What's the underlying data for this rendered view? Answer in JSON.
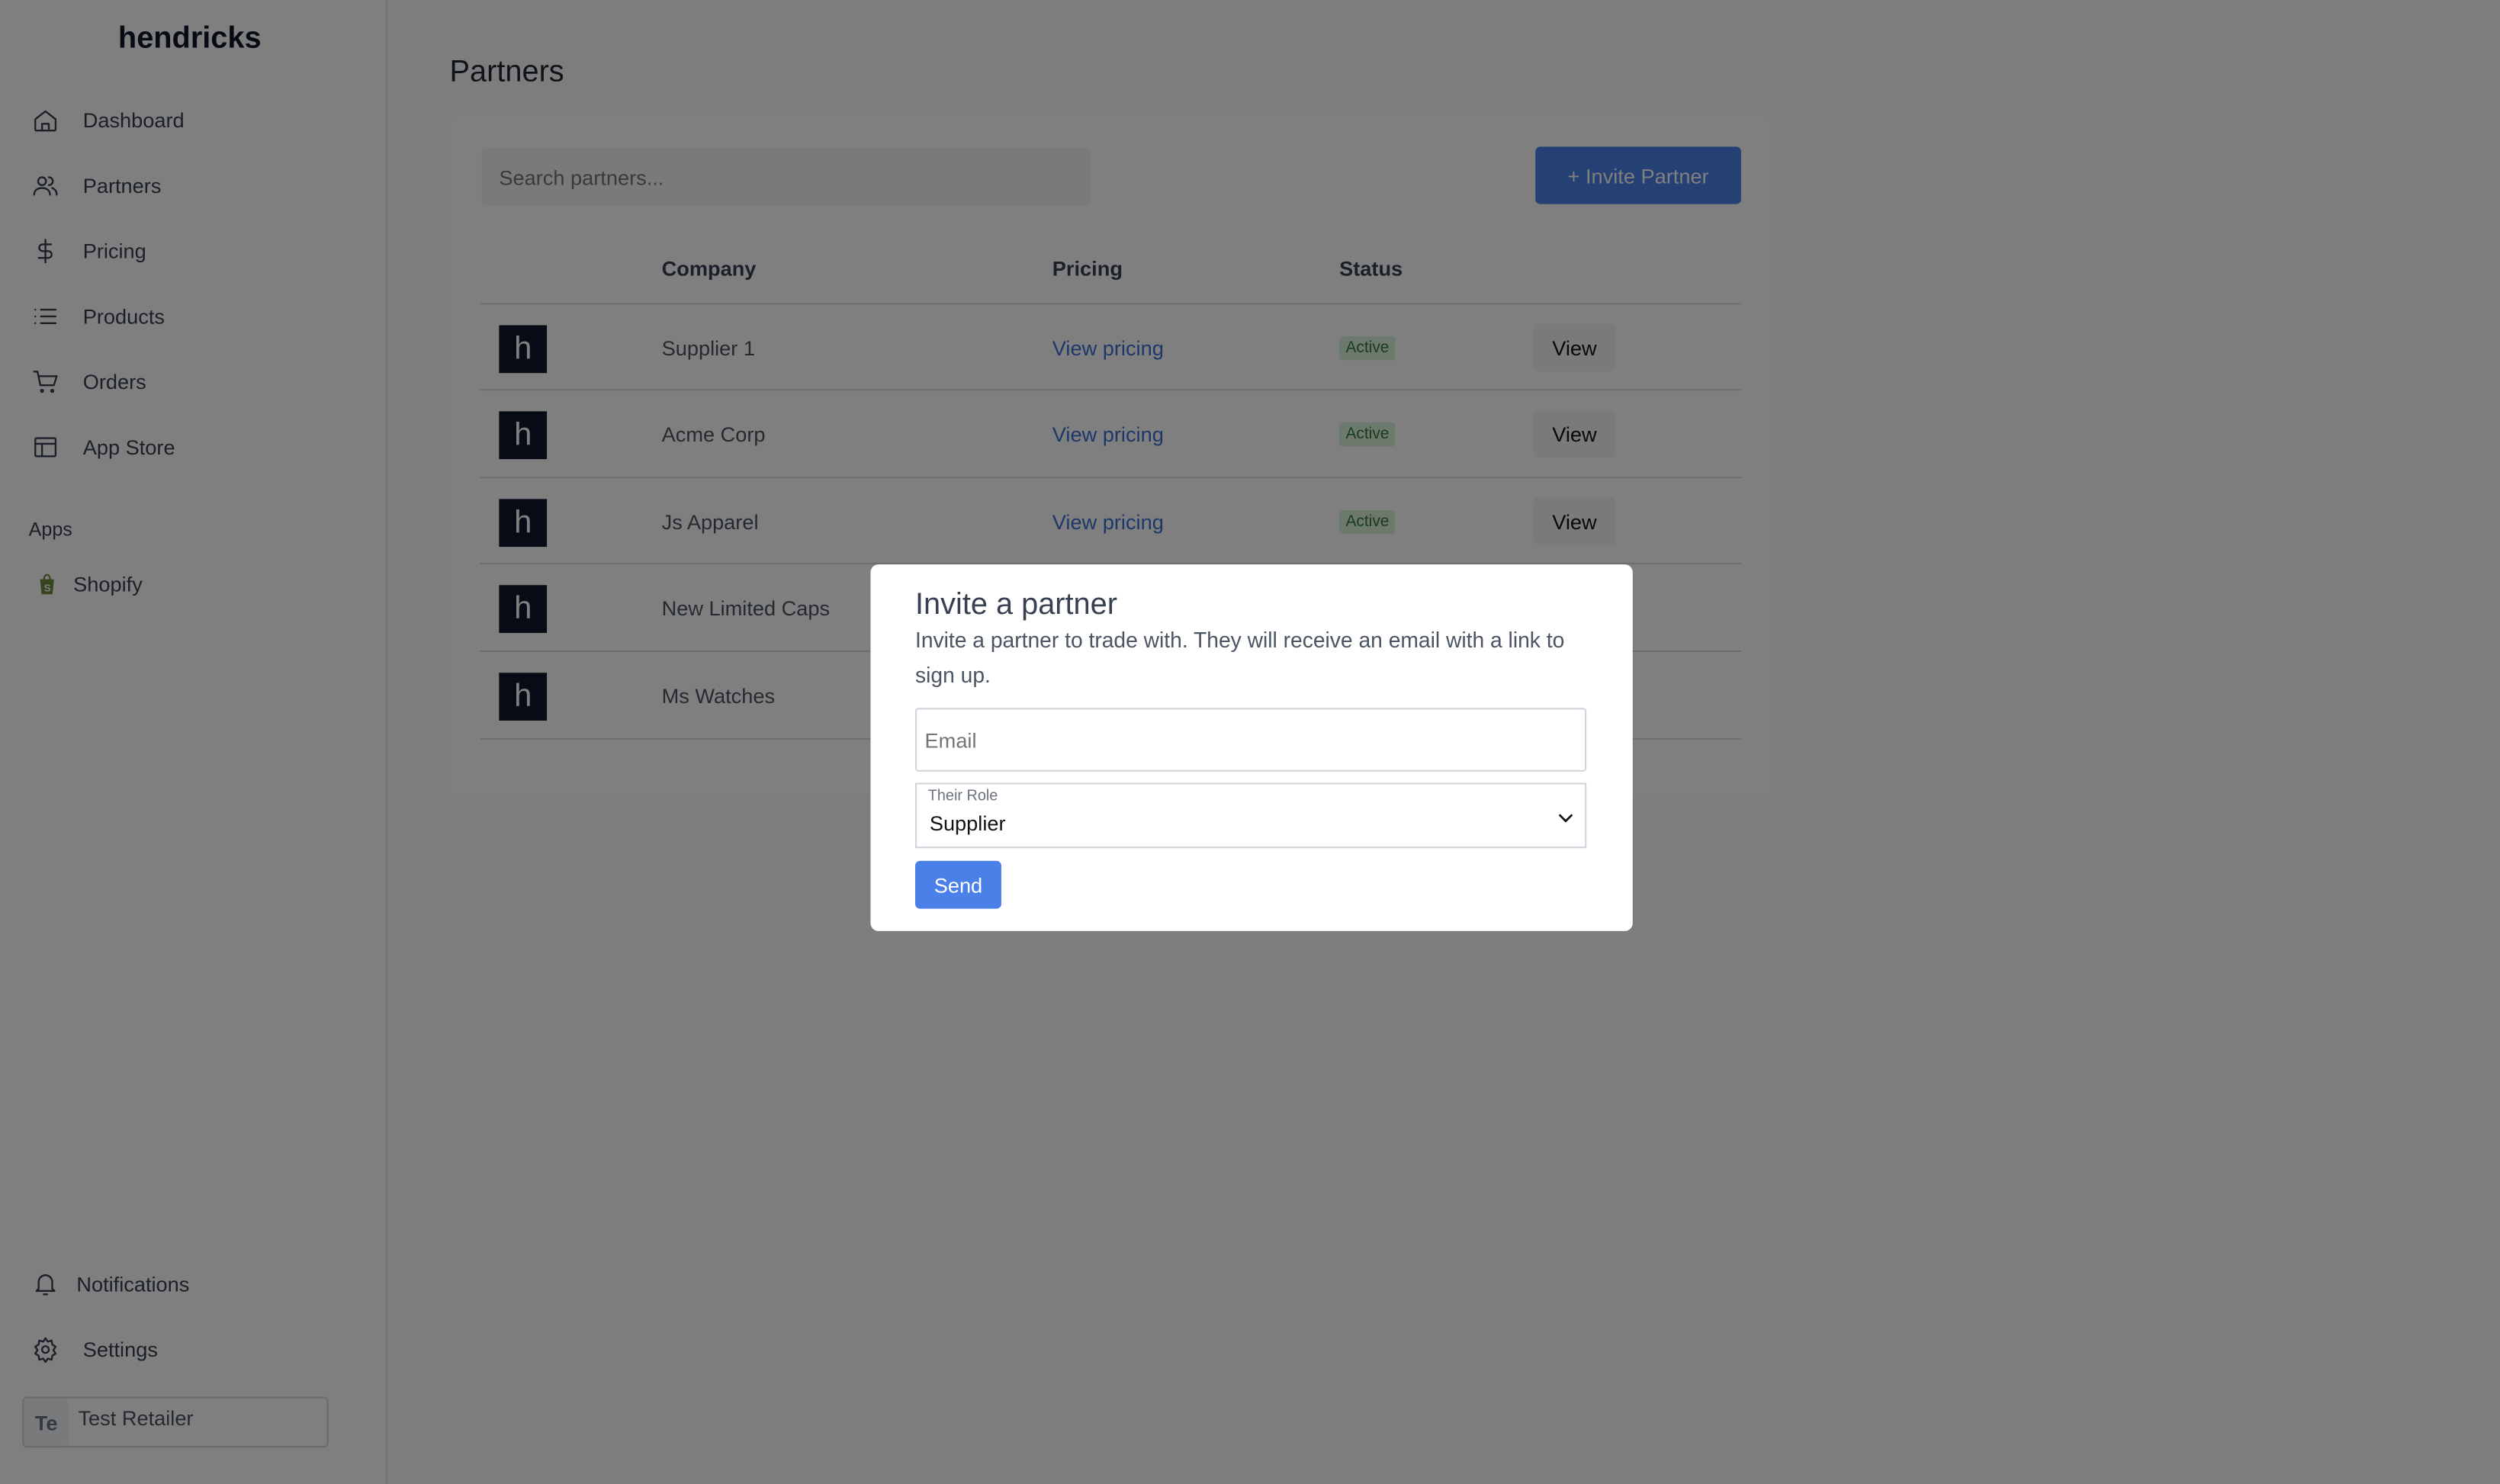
{
  "sidebar": {
    "brand": "hendricks",
    "items": [
      {
        "label": "Dashboard",
        "icon": "home-icon"
      },
      {
        "label": "Partners",
        "icon": "users-icon"
      },
      {
        "label": "Pricing",
        "icon": "dollar-icon"
      },
      {
        "label": "Products",
        "icon": "list-icon"
      },
      {
        "label": "Orders",
        "icon": "cart-icon"
      },
      {
        "label": "App Store",
        "icon": "layout-icon"
      }
    ],
    "apps_label": "Apps",
    "apps": [
      {
        "label": "Shopify",
        "icon": "shopify-icon",
        "color": "#95bf47"
      }
    ],
    "bottom": [
      {
        "label": "Notifications",
        "icon": "bell-icon"
      },
      {
        "label": "Settings",
        "icon": "gear-icon"
      }
    ],
    "user": {
      "initials": "Te",
      "name": "Test Retailer"
    }
  },
  "main": {
    "title": "Partners",
    "search_placeholder": "Search partners...",
    "invite_button": "+ Invite Partner",
    "columns": [
      "",
      "Company",
      "Pricing",
      "Status",
      ""
    ],
    "rows": [
      {
        "logo": "h",
        "company": "Supplier 1",
        "pricing": "View pricing",
        "status": "Active",
        "action": "View"
      },
      {
        "logo": "h",
        "company": "Acme Corp",
        "pricing": "View pricing",
        "status": "Active",
        "action": "View"
      },
      {
        "logo": "h",
        "company": "Js Apparel",
        "pricing": "View pricing",
        "status": "Active",
        "action": "View"
      },
      {
        "logo": "h",
        "company": "New Limited Caps"
      },
      {
        "logo": "h",
        "company": "Ms Watches"
      }
    ]
  },
  "modal": {
    "title": "Invite a partner",
    "description": "Invite a partner to trade with. They will receive an email with a link to sign up.",
    "email_placeholder": "Email",
    "email_value": "",
    "role_label": "Their Role",
    "role_value": "Supplier",
    "send_button": "Send"
  },
  "colors": {
    "accent": "#4a80e8",
    "active_badge": "#2f7a34",
    "link": "#3b6fd6"
  }
}
